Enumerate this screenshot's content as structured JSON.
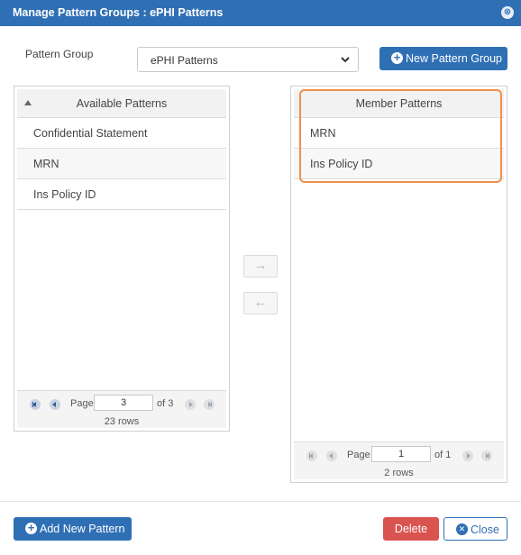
{
  "dialog": {
    "title": "Manage Pattern Groups : ePHI Patterns",
    "close_glyph": "⊗"
  },
  "pattern_group": {
    "label": "Pattern Group",
    "selected": "ePHI Patterns"
  },
  "new_group_button": {
    "label": "New Pattern Group",
    "icon": "plus-circle-icon"
  },
  "available": {
    "header": "Available Patterns",
    "rows": [
      "Confidential Statement",
      "MRN",
      "Ins Policy ID"
    ],
    "pager": {
      "page_label": "Page",
      "page": "3",
      "of_label": "of 3",
      "rows_info": "23 rows"
    }
  },
  "member": {
    "header": "Member Patterns",
    "rows": [
      "MRN",
      "Ins Policy ID"
    ],
    "pager": {
      "page_label": "Page",
      "page": "1",
      "of_label": "of 1",
      "rows_info": "2 rows"
    }
  },
  "move_buttons": {
    "add": "→",
    "remove": "←"
  },
  "footer": {
    "add_pattern": "Add New Pattern",
    "delete": "Delete",
    "close": "Close"
  },
  "colors": {
    "primary": "#2f6fb4",
    "danger": "#d9534f",
    "highlight": "#f0904a"
  }
}
